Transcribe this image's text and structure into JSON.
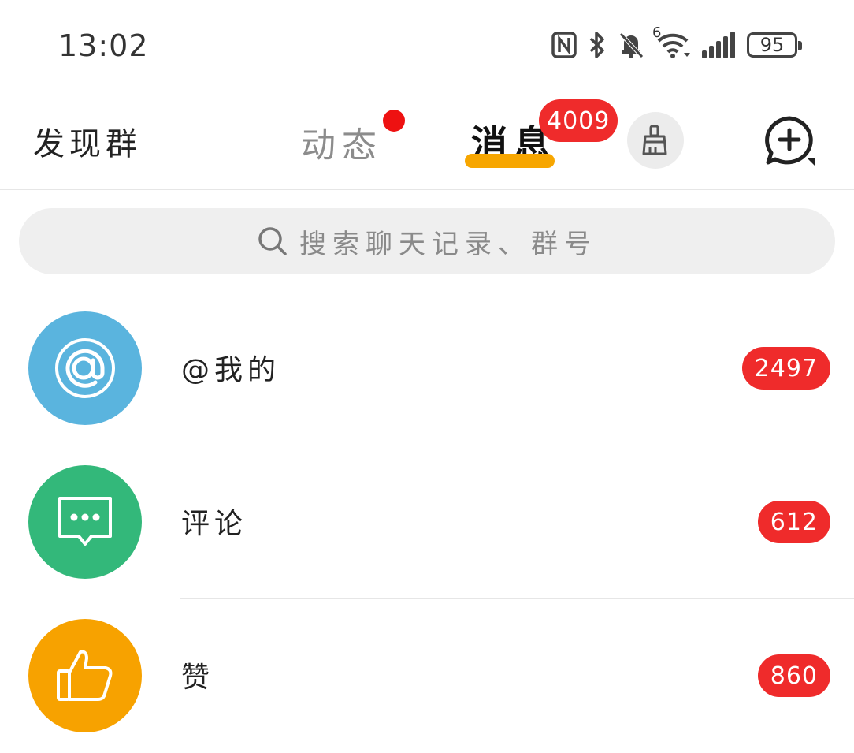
{
  "status_bar": {
    "time": "13:02",
    "battery": "95",
    "wifi_badge": "6"
  },
  "topnav": {
    "discover": "发现群",
    "feed": "动态",
    "messages": "消息",
    "messages_count": "4009"
  },
  "search": {
    "placeholder": "搜索聊天记录、群号"
  },
  "list": [
    {
      "title": "@我的",
      "count": "2497",
      "icon": "at-icon",
      "color": "#5ab4de"
    },
    {
      "title": "评论",
      "count": "612",
      "icon": "comment-icon",
      "color": "#33b87a"
    },
    {
      "title": "赞",
      "count": "860",
      "icon": "thumbs-up-icon",
      "color": "#f7a200"
    }
  ],
  "colors": {
    "accent": "#f7a600",
    "badge": "#ef2b2b"
  }
}
